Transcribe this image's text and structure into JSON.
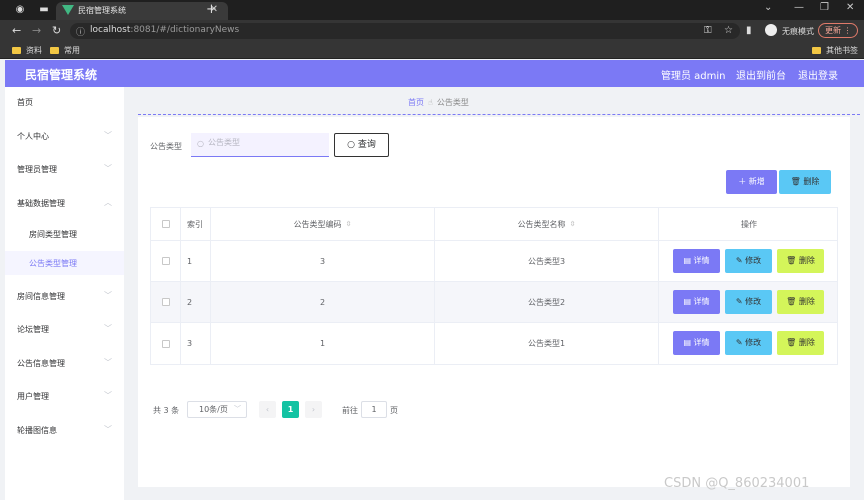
{
  "browser": {
    "tab_title": "民宿管理系统",
    "url_host": "localhost",
    "url_rest": ":8081/#/dictionaryNews",
    "incognito_label": "无痕模式",
    "update_label": "更新",
    "bookmarks": [
      "资料",
      "常用"
    ],
    "other_bookmarks": "其他书签"
  },
  "header": {
    "title": "民宿管理系统",
    "admin": "管理员 admin",
    "to_backend": "退出到前台",
    "logout": "退出登录"
  },
  "sidebar": {
    "items": [
      {
        "label": "首页"
      },
      {
        "label": "个人中心"
      },
      {
        "label": "管理员管理"
      },
      {
        "label": "基础数据管理"
      },
      {
        "label": "房间类型管理"
      },
      {
        "label": "公告类型管理"
      },
      {
        "label": "房间信息管理"
      },
      {
        "label": "论坛管理"
      },
      {
        "label": "公告信息管理"
      },
      {
        "label": "用户管理"
      },
      {
        "label": "轮播图信息"
      }
    ]
  },
  "breadcrumb": {
    "home": "首页",
    "current": "公告类型"
  },
  "search": {
    "label": "公告类型",
    "placeholder": "公告类型",
    "button": "查询"
  },
  "toolbar": {
    "add": "新增",
    "delete": "删除"
  },
  "table": {
    "headers": {
      "index": "索引",
      "code": "公告类型编码",
      "name": "公告类型名称",
      "actions": "操作"
    },
    "rows": [
      {
        "index": "1",
        "code": "3",
        "name": "公告类型3"
      },
      {
        "index": "2",
        "code": "2",
        "name": "公告类型2"
      },
      {
        "index": "3",
        "code": "1",
        "name": "公告类型1"
      }
    ],
    "actions": {
      "detail": "详情",
      "edit": "修改",
      "delete": "删除"
    }
  },
  "pagination": {
    "total": "共 3 条",
    "page_size": "10条/页",
    "current": "1",
    "goto": "前往",
    "goto_value": "1",
    "page_suffix": "页"
  },
  "watermark": "CSDN @Q_860234001",
  "colors": {
    "primary": "#7b79f5",
    "info": "#5ac8f5",
    "lime": "#d4f55a",
    "pager_active": "#13c3a3"
  }
}
